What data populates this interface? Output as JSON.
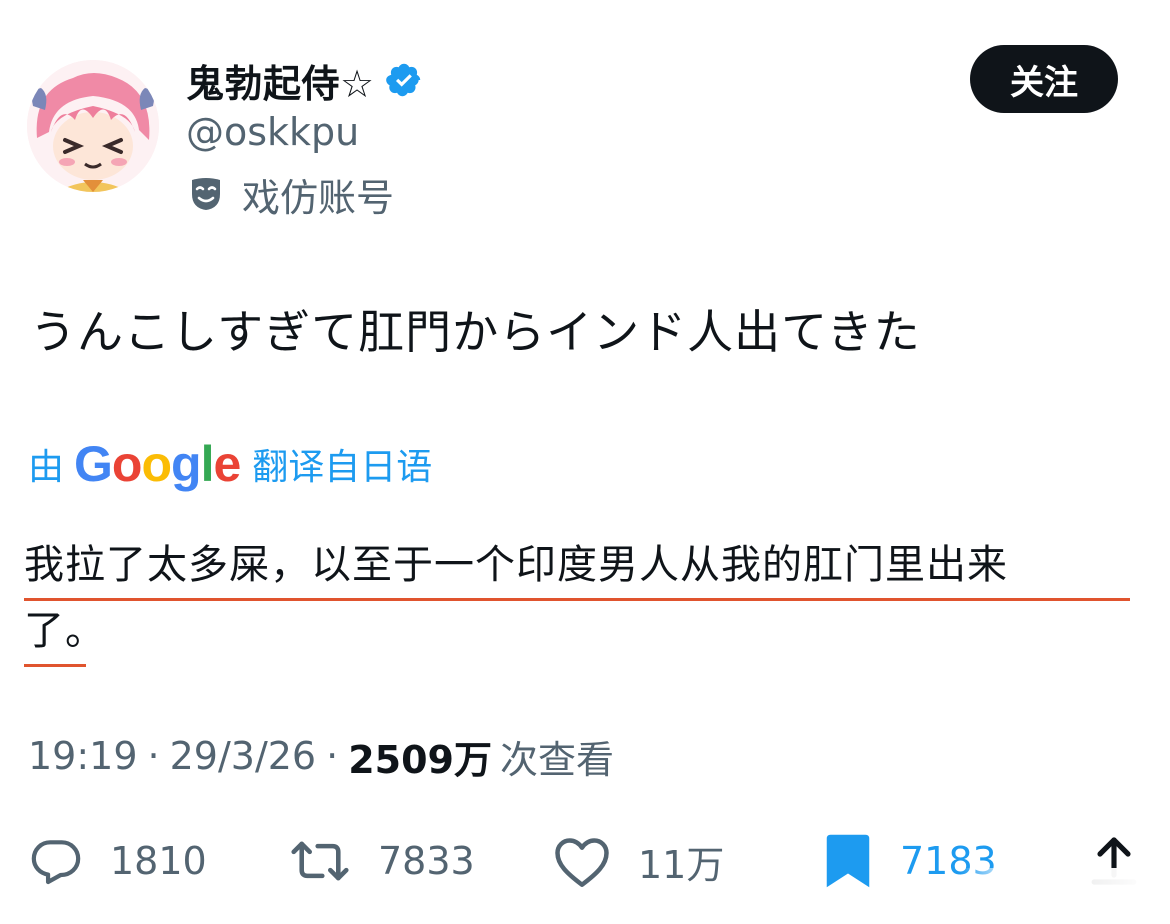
{
  "author": {
    "display_name": "鬼勃起侍☆",
    "handle": "@oskkpu",
    "parody_label": "戏仿账号",
    "verified": true
  },
  "follow_button": {
    "label": "关注"
  },
  "tweet": {
    "text": "うんこしすぎて肛門からインド人出てきた"
  },
  "translation": {
    "prefix": "由",
    "provider_logo_text": "Google",
    "suffix": "翻译自日语",
    "lines": [
      "我拉了太多屎，以至于一个印度男人从我的肛门里出来",
      "了。"
    ]
  },
  "meta": {
    "time": "19:19",
    "separator": "·",
    "date": "29/3/26",
    "views": "2509万",
    "views_label": "次查看"
  },
  "actions": {
    "replies": "1810",
    "retweets": "7833",
    "likes": "11万",
    "bookmarks": "7183"
  },
  "colors": {
    "text": "#0f1419",
    "secondary": "#536471",
    "accent": "#1d9bf0",
    "underline": "#e0542e",
    "follow_bg": "#0f1419"
  },
  "icons": {
    "verified": "verified-badge-icon",
    "parody": "parody-mask-icon",
    "reply": "reply-icon",
    "retweet": "retweet-icon",
    "like": "heart-icon",
    "bookmark": "bookmark-icon",
    "share": "share-icon"
  }
}
